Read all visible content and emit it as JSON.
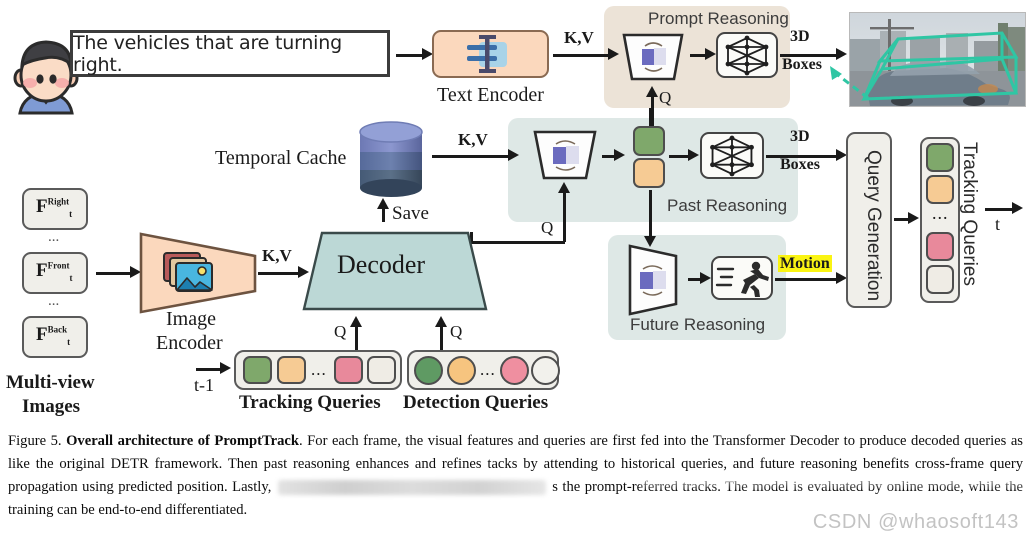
{
  "figure": {
    "number": "Figure 5.",
    "title": "Overall architecture of PromptTrack",
    "caption_p1": ". For each frame, the visual features and queries are first fed into the Transformer Decoder to produce decoded queries as like the original DETR framework. Then past reasoning enhances and refines tacks by attending to historical queries, and future reasoning benefits cross-frame query propagation using predicted position. Lastly, ",
    "caption_p2": " s the prompt-referred tracks. The model is evaluated by online mode, while the training can be end-to-end differentiated.",
    "watermark": "CSDN @whaosoft143"
  },
  "prompt": {
    "text": "The vehicles that are turning right.",
    "avatar": "user-avatar-icon"
  },
  "encoders": {
    "text_encoder_label": "Text Encoder",
    "text_encoder_icon": "text-cursor-icon",
    "image_encoder_label_1": "Image",
    "image_encoder_label_2": "Encoder",
    "image_encoder_icon": "photos-stack-icon",
    "decoder_label": "Decoder"
  },
  "multiview": {
    "caption_line1": "Multi-view",
    "caption_line2": "Images",
    "items": [
      {
        "base": "F",
        "sup": "Right",
        "sub": "t"
      },
      {
        "base": "F",
        "sup": "Front",
        "sub": "t"
      },
      {
        "base": "F",
        "sup": "Back",
        "sub": "t"
      }
    ],
    "ellipsis": "..."
  },
  "cache": {
    "label": "Temporal Cache",
    "save_label": "Save",
    "icon": "database-cylinder-icon"
  },
  "modules": {
    "prompt_reasoning": "Prompt Reasoning",
    "past_reasoning": "Past Reasoning",
    "future_reasoning": "Future Reasoning",
    "query_generation": "Query Generation",
    "cross_attn_icon": "cross-attention-swap-icon",
    "box3d_icon": "cube-wireframe-icon",
    "motion_icon": "running-person-icon"
  },
  "edges": {
    "kv": "K,V",
    "q": "Q",
    "boxes_line1": "3D",
    "boxes_line2": "Boxes",
    "motion": "Motion",
    "t_minus_1": "t-1",
    "t": "t"
  },
  "queries": {
    "tracking_label": "Tracking Queries",
    "detection_label": "Detection Queries",
    "tracking_vertical_label": "Tracking Queries",
    "ellipsis": "...",
    "tracking_colors": [
      "#7fa86b",
      "#f6cb94",
      "#e8899b",
      "#efece5"
    ],
    "detection_colors": [
      "#5f9a63",
      "#f6c47f",
      "#ef8fa0",
      "#f2f1ec"
    ]
  },
  "result_image": {
    "name": "3d-box-detection-result",
    "box_color": "#2fc6a4",
    "description": "street scene with car and 3D bounding boxes"
  },
  "colors": {
    "peach": "#fbd8bd",
    "teal_panel": "#dee8e6",
    "tan_panel": "#ece3d7",
    "decoder_fill": "#bcd8d6",
    "highlight_yellow": "#faf413"
  }
}
